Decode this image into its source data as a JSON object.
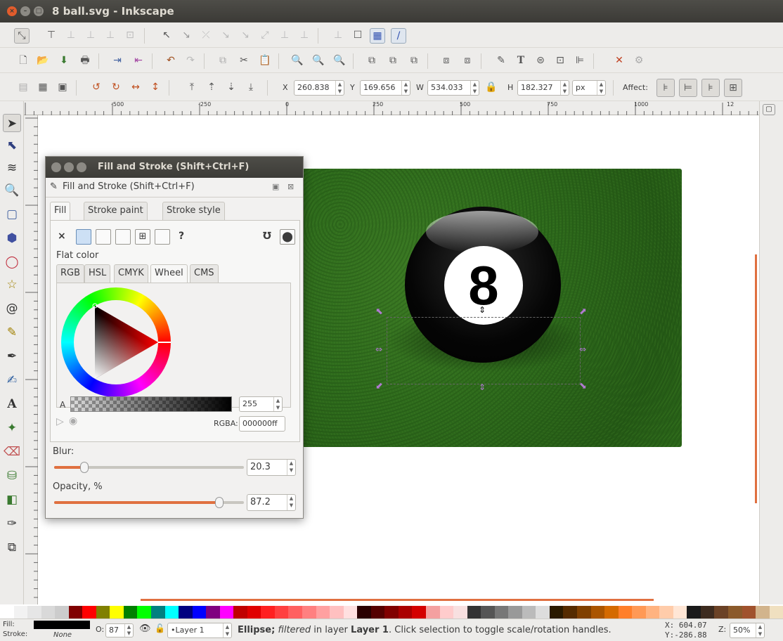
{
  "window": {
    "title": "8 ball.svg - Inkscape",
    "close": "×",
    "min": "–",
    "max": "□"
  },
  "toolbar_units": "px",
  "coords": {
    "x_label": "X",
    "x_value": "260.838",
    "y_label": "Y",
    "y_value": "169.656",
    "w_label": "W",
    "w_value": "534.033",
    "h_label": "H",
    "h_value": "182.327",
    "affect_label": "Affect:"
  },
  "ruler": {
    "ticks": [
      "-500",
      "-250",
      "0",
      "250",
      "500",
      "750",
      "1000",
      "12"
    ]
  },
  "dialog": {
    "window_title": "Fill and Stroke (Shift+Ctrl+F)",
    "panel_title": "Fill and Stroke (Shift+Ctrl+F)",
    "tabs": [
      "Fill",
      "Stroke paint",
      "Stroke style"
    ],
    "fill_none": "×",
    "fill_unknown": "?",
    "flat_color": "Flat color",
    "color_tabs": [
      "RGB",
      "HSL",
      "CMYK",
      "Wheel",
      "CMS"
    ],
    "alpha_label": "A",
    "alpha_value": "255",
    "rgba_label": "RGBA:",
    "rgba_value": "000000ff",
    "blur_label": "Blur:",
    "blur_value": "20.3",
    "blur_fraction": 0.16,
    "opacity_label": "Opacity, %",
    "opacity_value": "87.2",
    "opacity_fraction": 0.87
  },
  "canvas": {
    "ball_number": "8",
    "accent": "#e07040",
    "table_color": "#2e6b1c"
  },
  "status": {
    "fill_label": "Fill:",
    "stroke_label": "Stroke:",
    "stroke_value": "None",
    "o_label": "O:",
    "o_value": "87",
    "layer": "•Layer 1",
    "msg_object": "Ellipse;",
    "msg_filtered": "filtered",
    "msg_in_layer": "in layer",
    "msg_layer": "Layer 1",
    "msg_rest": ". Click selection to toggle scale/rotation handles.",
    "x_label": "X:",
    "x_value": "604.07",
    "y_label": "Y:",
    "y_value": "-286.88",
    "z_label": "Z:",
    "zoom": "50%"
  },
  "palette_colors": [
    "#ffffff",
    "#f2f2f2",
    "#e6e6e6",
    "#d9d9d9",
    "#cccccc",
    "#800000",
    "#ff0000",
    "#808000",
    "#ffff00",
    "#008000",
    "#00ff00",
    "#008080",
    "#00ffff",
    "#000080",
    "#0000ff",
    "#800080",
    "#ff00ff",
    "#c00000",
    "#e00000",
    "#ff2020",
    "#ff4040",
    "#ff6060",
    "#ff8080",
    "#ffa0a0",
    "#ffc0c0",
    "#ffe0e0",
    "#2a0000",
    "#550000",
    "#800000",
    "#aa0000",
    "#d40000",
    "#f4a0a0",
    "#ffcccc",
    "#f8e0e0",
    "#333333",
    "#555555",
    "#777777",
    "#999999",
    "#bbbbbb",
    "#dddddd",
    "#2a1a00",
    "#552b00",
    "#804000",
    "#aa5500",
    "#d46a00",
    "#ff7f2a",
    "#ff9955",
    "#ffb380",
    "#ffccaa",
    "#ffe6d5",
    "#1a1a1a",
    "#3d2b1f",
    "#6b4226",
    "#8b5a2b",
    "#a0522d",
    "#d2b48c",
    "#f0e0c0"
  ]
}
